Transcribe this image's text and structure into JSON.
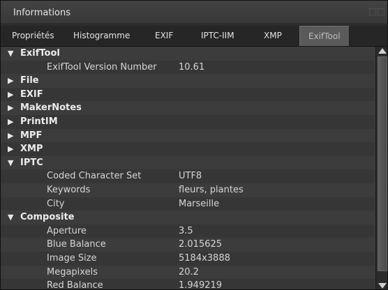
{
  "panel": {
    "title": "Informations"
  },
  "tabs": [
    {
      "label": "Propriétés",
      "active": false
    },
    {
      "label": "Histogramme",
      "active": false
    },
    {
      "label": "EXIF",
      "active": false
    },
    {
      "label": "IPTC-IIM",
      "active": false
    },
    {
      "label": "XMP",
      "active": false
    },
    {
      "label": "ExifTool",
      "active": true
    }
  ],
  "rows": [
    {
      "type": "group",
      "label": "ExifTool",
      "expanded": true
    },
    {
      "type": "field",
      "key": "ExifTool Version Number",
      "value": "10.61"
    },
    {
      "type": "group",
      "label": "File",
      "expanded": false
    },
    {
      "type": "group",
      "label": "EXIF",
      "expanded": false
    },
    {
      "type": "group",
      "label": "MakerNotes",
      "expanded": false
    },
    {
      "type": "group",
      "label": "PrintIM",
      "expanded": false
    },
    {
      "type": "group",
      "label": "MPF",
      "expanded": false
    },
    {
      "type": "group",
      "label": "XMP",
      "expanded": false
    },
    {
      "type": "group",
      "label": "IPTC",
      "expanded": true
    },
    {
      "type": "field",
      "key": "Coded Character Set",
      "value": "UTF8"
    },
    {
      "type": "field",
      "key": "Keywords",
      "value": "fleurs, plantes"
    },
    {
      "type": "field",
      "key": "City",
      "value": "Marseille"
    },
    {
      "type": "group",
      "label": "Composite",
      "expanded": true
    },
    {
      "type": "field",
      "key": "Aperture",
      "value": "3.5"
    },
    {
      "type": "field",
      "key": "Blue Balance",
      "value": "2.015625"
    },
    {
      "type": "field",
      "key": "Image Size",
      "value": "5184x3888"
    },
    {
      "type": "field",
      "key": "Megapixels",
      "value": "20.2"
    },
    {
      "type": "field",
      "key": "Red Balance",
      "value": "1.949219"
    }
  ],
  "icons": {
    "expanded": "▼",
    "collapsed": "▶"
  }
}
